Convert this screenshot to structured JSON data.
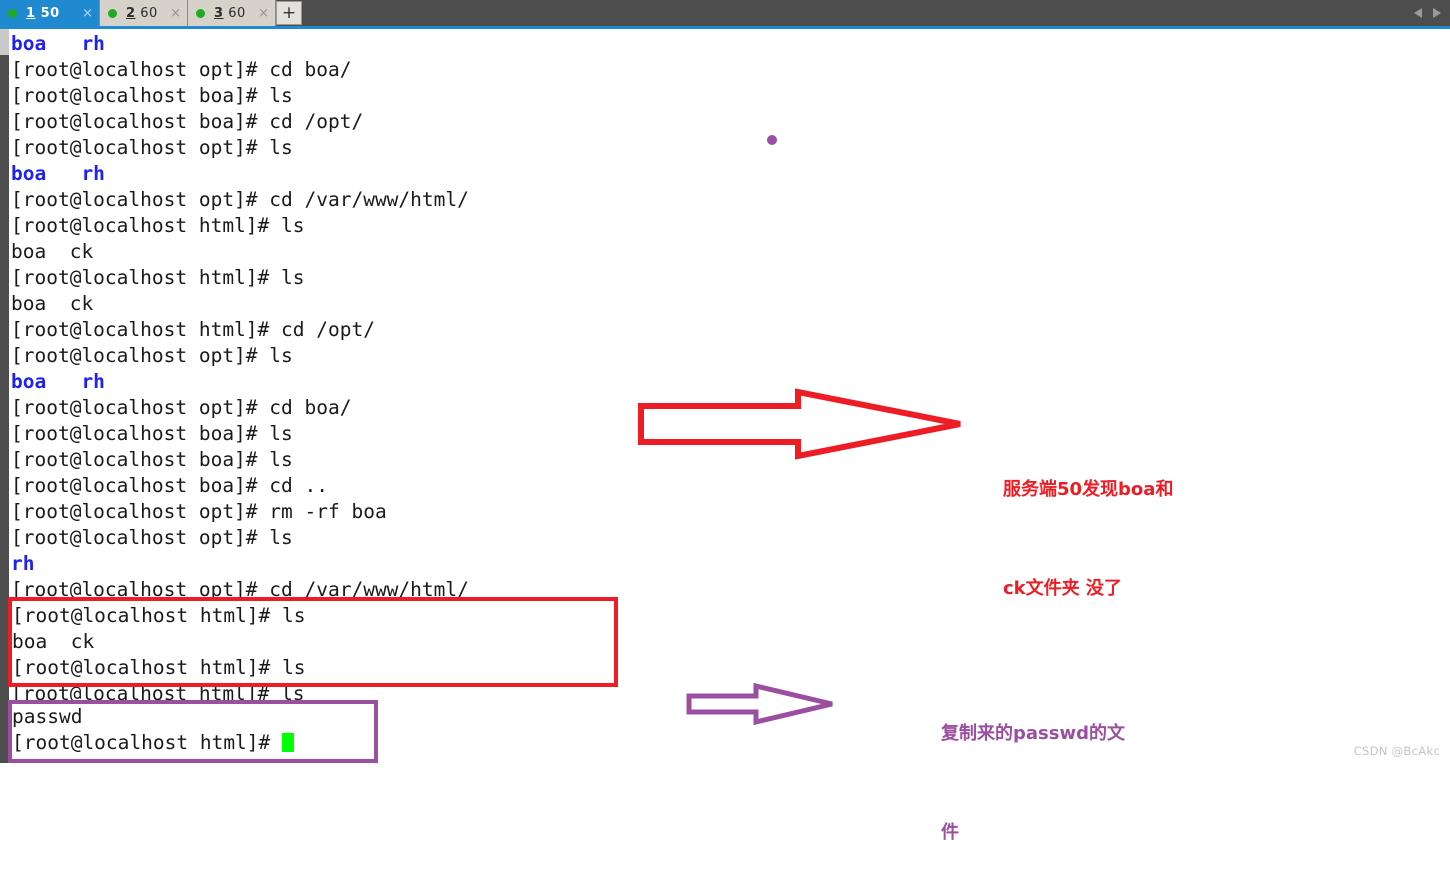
{
  "tabbar": {
    "tabs": [
      {
        "index": "1",
        "title": "50",
        "dot": "status-dot-green",
        "close": "×",
        "active": true
      },
      {
        "index": "2",
        "title": "60",
        "dot": "status-dot-green",
        "close": "×",
        "active": false
      },
      {
        "index": "3",
        "title": "60",
        "dot": "status-dot-green",
        "close": "×",
        "active": false
      }
    ],
    "add_label": "+",
    "scroll_left": "◀",
    "scroll_right": "▶",
    "accent_color": "#1f8ad0",
    "inactive_color": "#d6d2ca",
    "bar_color": "#4d4d4d"
  },
  "terminal": {
    "lines": [
      {
        "text": "boa   rh",
        "type": "dir"
      },
      {
        "text": "[root@localhost opt]# cd boa/",
        "type": "normal"
      },
      {
        "text": "[root@localhost boa]# ls",
        "type": "normal"
      },
      {
        "text": "[root@localhost boa]# cd /opt/",
        "type": "normal"
      },
      {
        "text": "[root@localhost opt]# ls",
        "type": "normal"
      },
      {
        "text": "boa   rh",
        "type": "dir"
      },
      {
        "text": "[root@localhost opt]# cd /var/www/html/",
        "type": "normal"
      },
      {
        "text": "[root@localhost html]# ls",
        "type": "normal"
      },
      {
        "text": "boa  ck",
        "type": "normal"
      },
      {
        "text": "[root@localhost html]# ls",
        "type": "normal"
      },
      {
        "text": "boa  ck",
        "type": "normal"
      },
      {
        "text": "[root@localhost html]# cd /opt/",
        "type": "normal"
      },
      {
        "text": "[root@localhost opt]# ls",
        "type": "normal"
      },
      {
        "text": "boa   rh",
        "type": "dir"
      },
      {
        "text": "[root@localhost opt]# cd boa/",
        "type": "normal"
      },
      {
        "text": "[root@localhost boa]# ls",
        "type": "normal"
      },
      {
        "text": "[root@localhost boa]# ls",
        "type": "normal"
      },
      {
        "text": "[root@localhost boa]# cd ..",
        "type": "normal"
      },
      {
        "text": "[root@localhost opt]# rm -rf boa",
        "type": "normal"
      },
      {
        "text": "[root@localhost opt]# ls",
        "type": "normal"
      },
      {
        "text": "rh",
        "type": "dir"
      },
      {
        "text": "[root@localhost opt]# cd /var/www/html/",
        "type": "normal"
      },
      {
        "text": "[root@localhost html]# ls",
        "type": "normal"
      },
      {
        "text": "boa  ck",
        "type": "normal"
      },
      {
        "text": "[root@localhost html]# ls",
        "type": "normal"
      },
      {
        "text": "[root@localhost html]# ls",
        "type": "normal"
      },
      {
        "text": "passwd",
        "type": "normal"
      },
      {
        "text": "[root@localhost html]# ",
        "type": "prompt-cursor"
      }
    ],
    "cursor_color": "#00ff00",
    "dir_color": "#2222ee",
    "text_color": "#1a1a1a"
  },
  "highlight_red_box": {
    "color": "#ee1c25",
    "lines": [
      "[root@localhost html]# ls",
      "boa  ck",
      "[root@localhost html]# ls"
    ]
  },
  "highlight_purple_box": {
    "color": "#9b4fa0",
    "lines": [
      "passwd",
      "[root@localhost html]# "
    ]
  },
  "annotations": {
    "red_note_line1": "服务端50发现boa和",
    "red_note_line2": "ck文件夹 没了",
    "purple_note_line1": "复制来的passwd的文",
    "purple_note_line2": "件"
  },
  "watermark": "CSDN @BcAkc"
}
